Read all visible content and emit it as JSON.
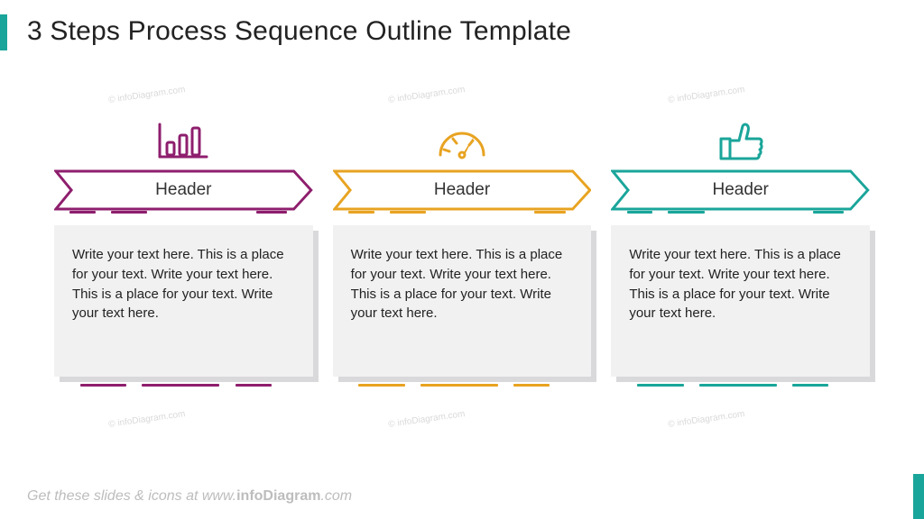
{
  "title": "3 Steps Process Sequence Outline Template",
  "footer": {
    "prefix": "Get these slides & icons at ",
    "domain_prefix": "www.",
    "domain_bold": "infoDiagram",
    "domain_suffix": ".com"
  },
  "watermark": "© infoDiagram.com",
  "colors": {
    "step1": "#8e1e6d",
    "step2": "#e8a321",
    "step3": "#1aa59a"
  },
  "steps": [
    {
      "icon": "bar-chart-icon",
      "header": "Header",
      "body": "Write your text here. This is a place for your text. Write your text here. This is a place for your text. Write your text here."
    },
    {
      "icon": "gauge-icon",
      "header": "Header",
      "body": "Write your text here. This is a place for your text. Write your text here. This is a place for your text. Write your text here."
    },
    {
      "icon": "thumbs-up-icon",
      "header": "Header",
      "body": "Write your text here. This is a place for your text. Write your text here. This is a place for your text. Write your text here."
    }
  ]
}
